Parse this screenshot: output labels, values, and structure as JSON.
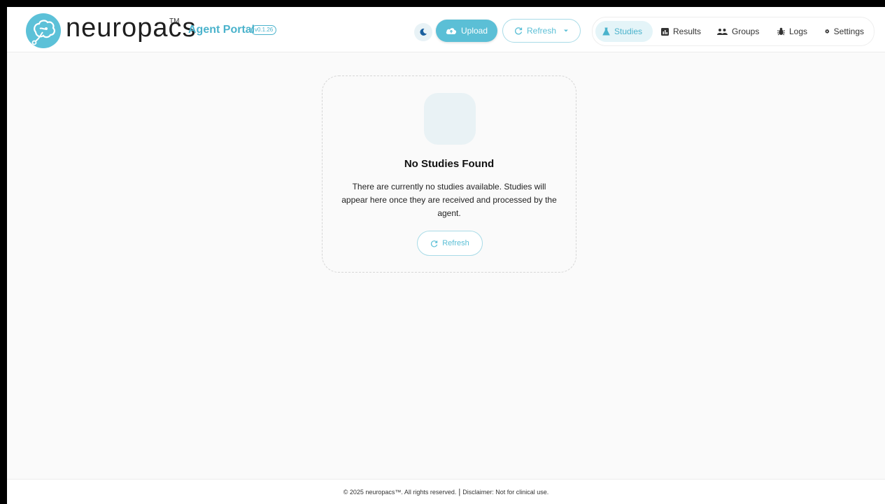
{
  "header": {
    "brand": "neuropacs",
    "trademark": "TM",
    "portal_title": "Agent Portal",
    "version": "v0.1.26",
    "theme_icon": "moon-icon",
    "upload_label": "Upload",
    "upload_icon": "cloud-upload-icon",
    "refresh_label": "Refresh",
    "refresh_icon": "refresh-icon",
    "refresh_dropdown_icon": "caret-down-icon"
  },
  "nav": {
    "items": [
      {
        "label": "Studies",
        "icon": "flask-icon",
        "active": true
      },
      {
        "label": "Results",
        "icon": "chart-icon",
        "active": false
      },
      {
        "label": "Groups",
        "icon": "group-icon",
        "active": false
      },
      {
        "label": "Logs",
        "icon": "bug-icon",
        "active": false
      },
      {
        "label": "Settings",
        "icon": "gear-icon",
        "active": false
      }
    ]
  },
  "empty_state": {
    "title": "No Studies Found",
    "message": "There are currently no studies available. Studies will appear here once they are received and processed by the agent.",
    "refresh_label": "Refresh"
  },
  "footer": {
    "copyright": "© 2025 neuropacs™. All rights reserved.",
    "separator": "|",
    "disclaimer": "Disclaimer: Not for clinical use."
  },
  "colors": {
    "accent": "#5bbfd6",
    "accent_text": "#4bb3cc",
    "active_nav_bg": "#e4f4f8",
    "page_bg": "#fafafa"
  }
}
